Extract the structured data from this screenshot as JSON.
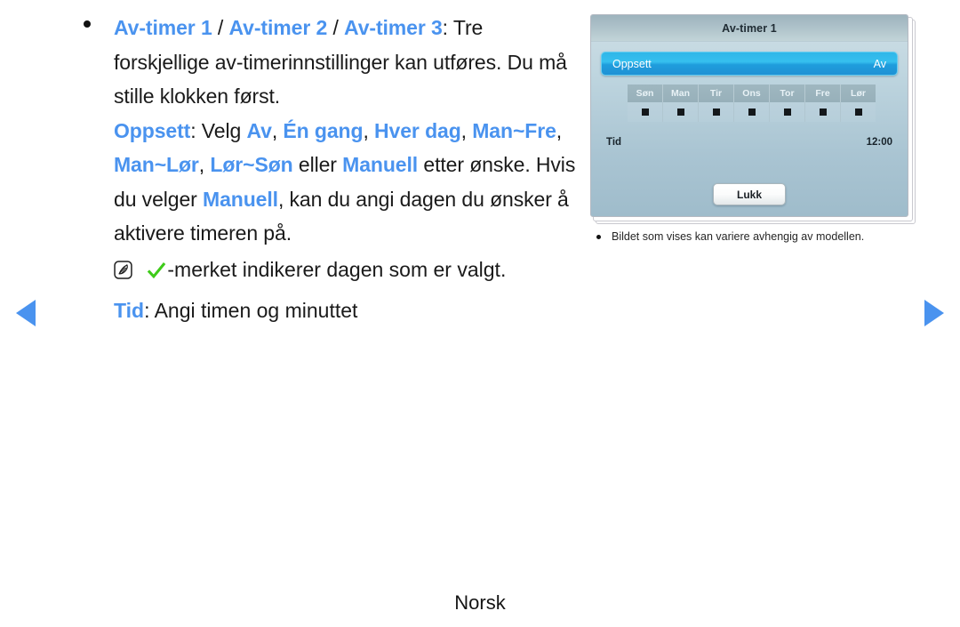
{
  "nav": {
    "prev_icon": "triangle-left-icon",
    "next_icon": "triangle-right-icon",
    "arrow_color": "#4a93ef"
  },
  "content": {
    "accent_color": "#4a93ef",
    "bullet_item": {
      "terms": [
        "Av-timer 1",
        "Av-timer 2",
        "Av-timer 3"
      ],
      "sep": " / ",
      "colon": ": ",
      "body": "Tre forskjellige av-timerinnstillinger kan utføres. Du må stille klokken først.",
      "line1_tail": "Tre",
      "line2": "forskjellige av-timerinnstillinger kan utføres.",
      "line3": "Du må stille klokken først."
    },
    "oppsett": {
      "label": "Oppsett",
      "intro": ": Velg ",
      "options": [
        "Av",
        "Én gang",
        "Hver dag",
        "Man~Fre",
        "Man~Lør",
        "Lør~Søn"
      ],
      "conjunction": " eller ",
      "last_option": "Manuell",
      "tail_1": "etter ønske. Hvis du velger ",
      "tail_manuell": "Manuell",
      "tail_2": ", kan du",
      "tail_3": "angi dagen du ønsker å aktivere timeren på."
    },
    "note": {
      "icon": "note-pen-icon",
      "check_icon": "green-check-icon",
      "check_color": "#3ecb19",
      "text": "-merket indikerer dagen som er valgt."
    },
    "tid": {
      "label": "Tid",
      "text": ": Angi timen og minuttet"
    }
  },
  "osd": {
    "title": "Av-timer 1",
    "highlight": {
      "label": "Oppsett",
      "value": "Av",
      "color": "#2fb6e8"
    },
    "days": [
      "Søn",
      "Man",
      "Tir",
      "Ons",
      "Tor",
      "Fre",
      "Lør"
    ],
    "day_checkboxes": [
      "checkbox-icon",
      "checkbox-icon",
      "checkbox-icon",
      "checkbox-icon",
      "checkbox-icon",
      "checkbox-icon",
      "checkbox-icon"
    ],
    "time_row": {
      "label": "Tid",
      "value": "12:00"
    },
    "close_button": "Lukk"
  },
  "caption": {
    "line1": "Bildet som vises kan variere avhengig av",
    "line2": "modellen."
  },
  "footer": {
    "language": "Norsk"
  }
}
